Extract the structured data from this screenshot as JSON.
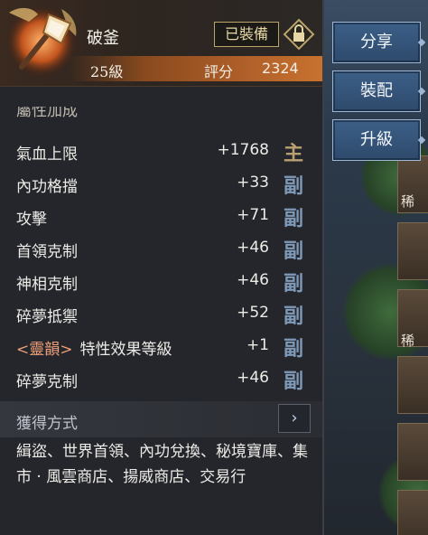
{
  "item": {
    "name": "破釜",
    "status_badge": "已裝備",
    "level": "25級",
    "score_label": "評分",
    "score_value": "2324"
  },
  "section": {
    "attributes_title": "屬性加成"
  },
  "attributes": [
    {
      "tag": "",
      "name": "氣血上限",
      "value": "+1768",
      "type": "主"
    },
    {
      "tag": "",
      "name": "內功格擋",
      "value": "+33",
      "type": "副"
    },
    {
      "tag": "",
      "name": "攻擊",
      "value": "+71",
      "type": "副"
    },
    {
      "tag": "",
      "name": "首領克制",
      "value": "+46",
      "type": "副"
    },
    {
      "tag": "",
      "name": "神相克制",
      "value": "+46",
      "type": "副"
    },
    {
      "tag": "",
      "name": "碎夢抵禦",
      "value": "+52",
      "type": "副"
    },
    {
      "tag": "<靈韻>",
      "name": "特性效果等級",
      "value": "+1",
      "type": "副"
    },
    {
      "tag": "",
      "name": "碎夢克制",
      "value": "+46",
      "type": "副"
    }
  ],
  "acquisition": {
    "title": "獲得方式",
    "text": "緝盜、世界首領、內功兌換、秘境寶庫、集市 · 風雲商店、揚威商店、交易行"
  },
  "side_buttons": {
    "share": "分享",
    "equip": "裝配",
    "upgrade": "升級"
  },
  "right_slots": {
    "tag": "稀"
  },
  "colors": {
    "main_type": "#b9a071",
    "sub_type": "#7f99b8",
    "score_bar": "#c8722e",
    "button_bg": "#3c5f87",
    "tag_color": "#f0a07a"
  },
  "icons": {
    "item": "axe-weapon-icon",
    "lock": "lock-icon",
    "arrow": "chevron-right-icon"
  }
}
